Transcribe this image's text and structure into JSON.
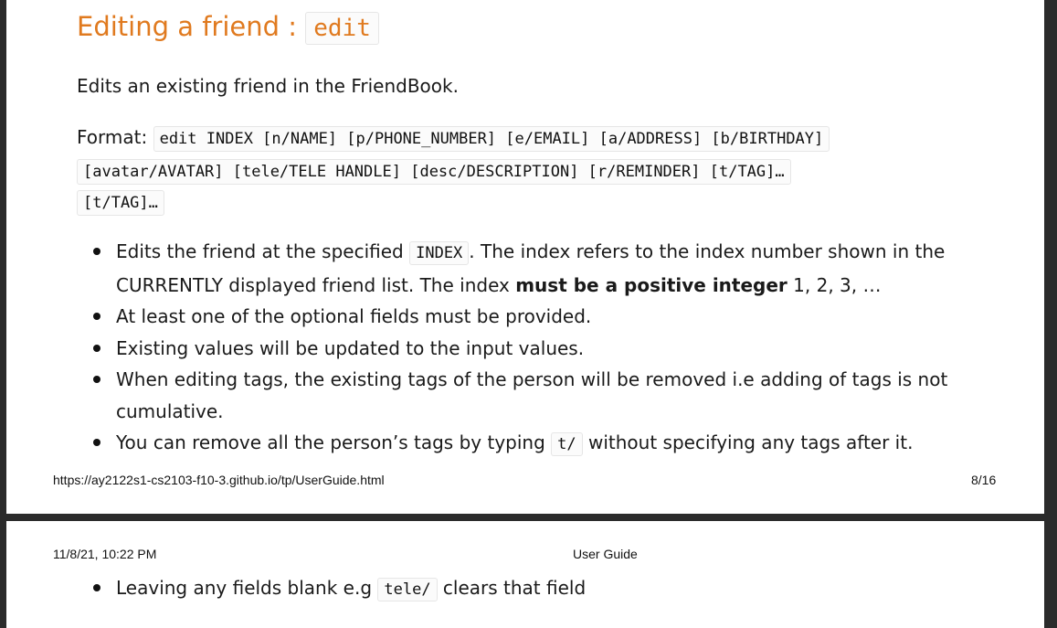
{
  "page1": {
    "heading_text": "Editing a friend : ",
    "heading_code": "edit",
    "description": "Edits an existing friend in the FriendBook.",
    "format_label": "Format: ",
    "format_line1": "edit INDEX [n/NAME] [p/PHONE_NUMBER] [e/EMAIL] [a/ADDRESS] [b/BIRTHDAY]",
    "format_line2": "[avatar/AVATAR] [tele/TELE HANDLE] [desc/DESCRIPTION] [r/REMINDER] [t/TAG]…",
    "format_line3": "[t/TAG]…",
    "bullets": {
      "b1_pre": "Edits the friend at the specified ",
      "b1_code": "INDEX",
      "b1_mid": ". The index refers to the index number shown in the",
      "b1_line2_pre": "CURRENTLY displayed friend list. The index ",
      "b1_bold": "must be a positive integer",
      "b1_post": " 1, 2, 3, …",
      "b2": "At least one of the optional fields must be provided.",
      "b3": "Existing values will be updated to the input values.",
      "b4_line1": "When editing tags, the existing tags of the person will be removed i.e adding of tags is not",
      "b4_line2": "cumulative.",
      "b5_pre": "You can remove all the person’s tags by typing ",
      "b5_code": "t/",
      "b5_post": " without specifying any tags after it."
    },
    "footer_url": "https://ay2122s1-cs2103-f10-3.github.io/tp/UserGuide.html",
    "footer_page": "8/16"
  },
  "page2": {
    "header_date": "11/8/21, 10:22 PM",
    "header_title": "User Guide",
    "bullet_pre": "Leaving any fields blank e.g ",
    "bullet_code": "tele/",
    "bullet_post": " clears that field"
  }
}
